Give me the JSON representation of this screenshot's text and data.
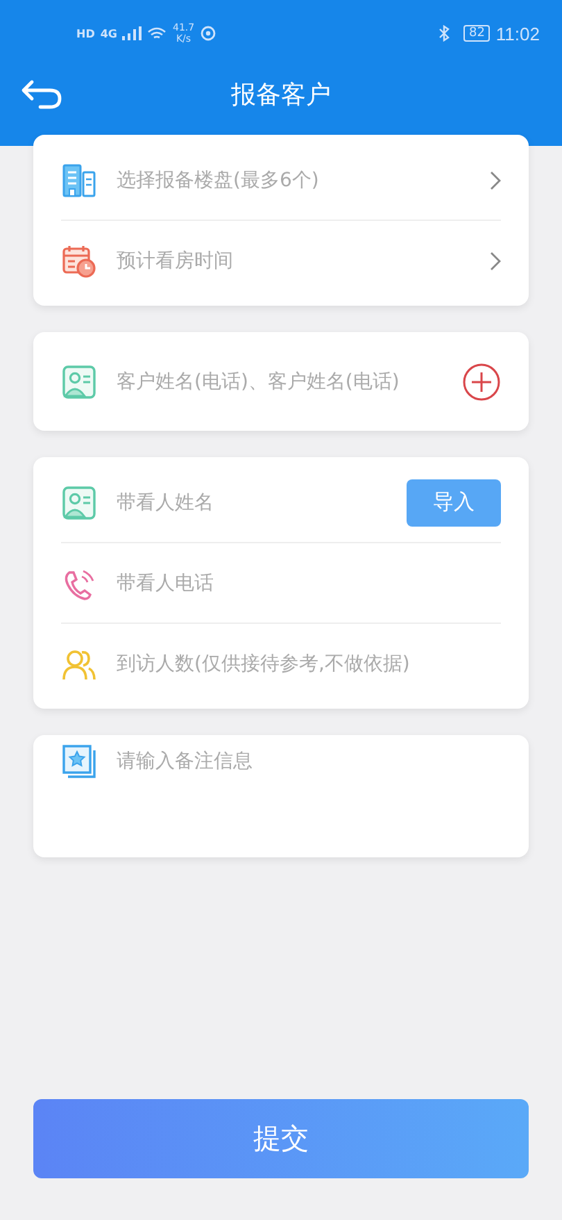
{
  "status_bar": {
    "left": [
      "HD",
      "4G"
    ],
    "speed": "41.7",
    "speed_unit": "K/s",
    "battery": "82",
    "time": "11:02"
  },
  "header": {
    "title": "报备客户"
  },
  "cards": [
    {
      "rows": [
        {
          "kind": "select",
          "placeholder": "选择报备楼盘(最多6个)"
        },
        {
          "kind": "select",
          "placeholder": "预计看房时间"
        }
      ]
    },
    {
      "rows": [
        {
          "kind": "add",
          "placeholder": "客户姓名(电话)、客户姓名(电话)"
        }
      ]
    },
    {
      "rows": [
        {
          "kind": "action",
          "placeholder": "带看人姓名",
          "action": "导入"
        },
        {
          "kind": "input",
          "placeholder": "带看人电话"
        },
        {
          "kind": "input",
          "placeholder": "到访人数(仅供接待参考,不做依据)"
        }
      ]
    },
    {
      "rows": [
        {
          "kind": "textarea",
          "placeholder": "请输入备注信息"
        }
      ]
    }
  ],
  "submit": "提交"
}
